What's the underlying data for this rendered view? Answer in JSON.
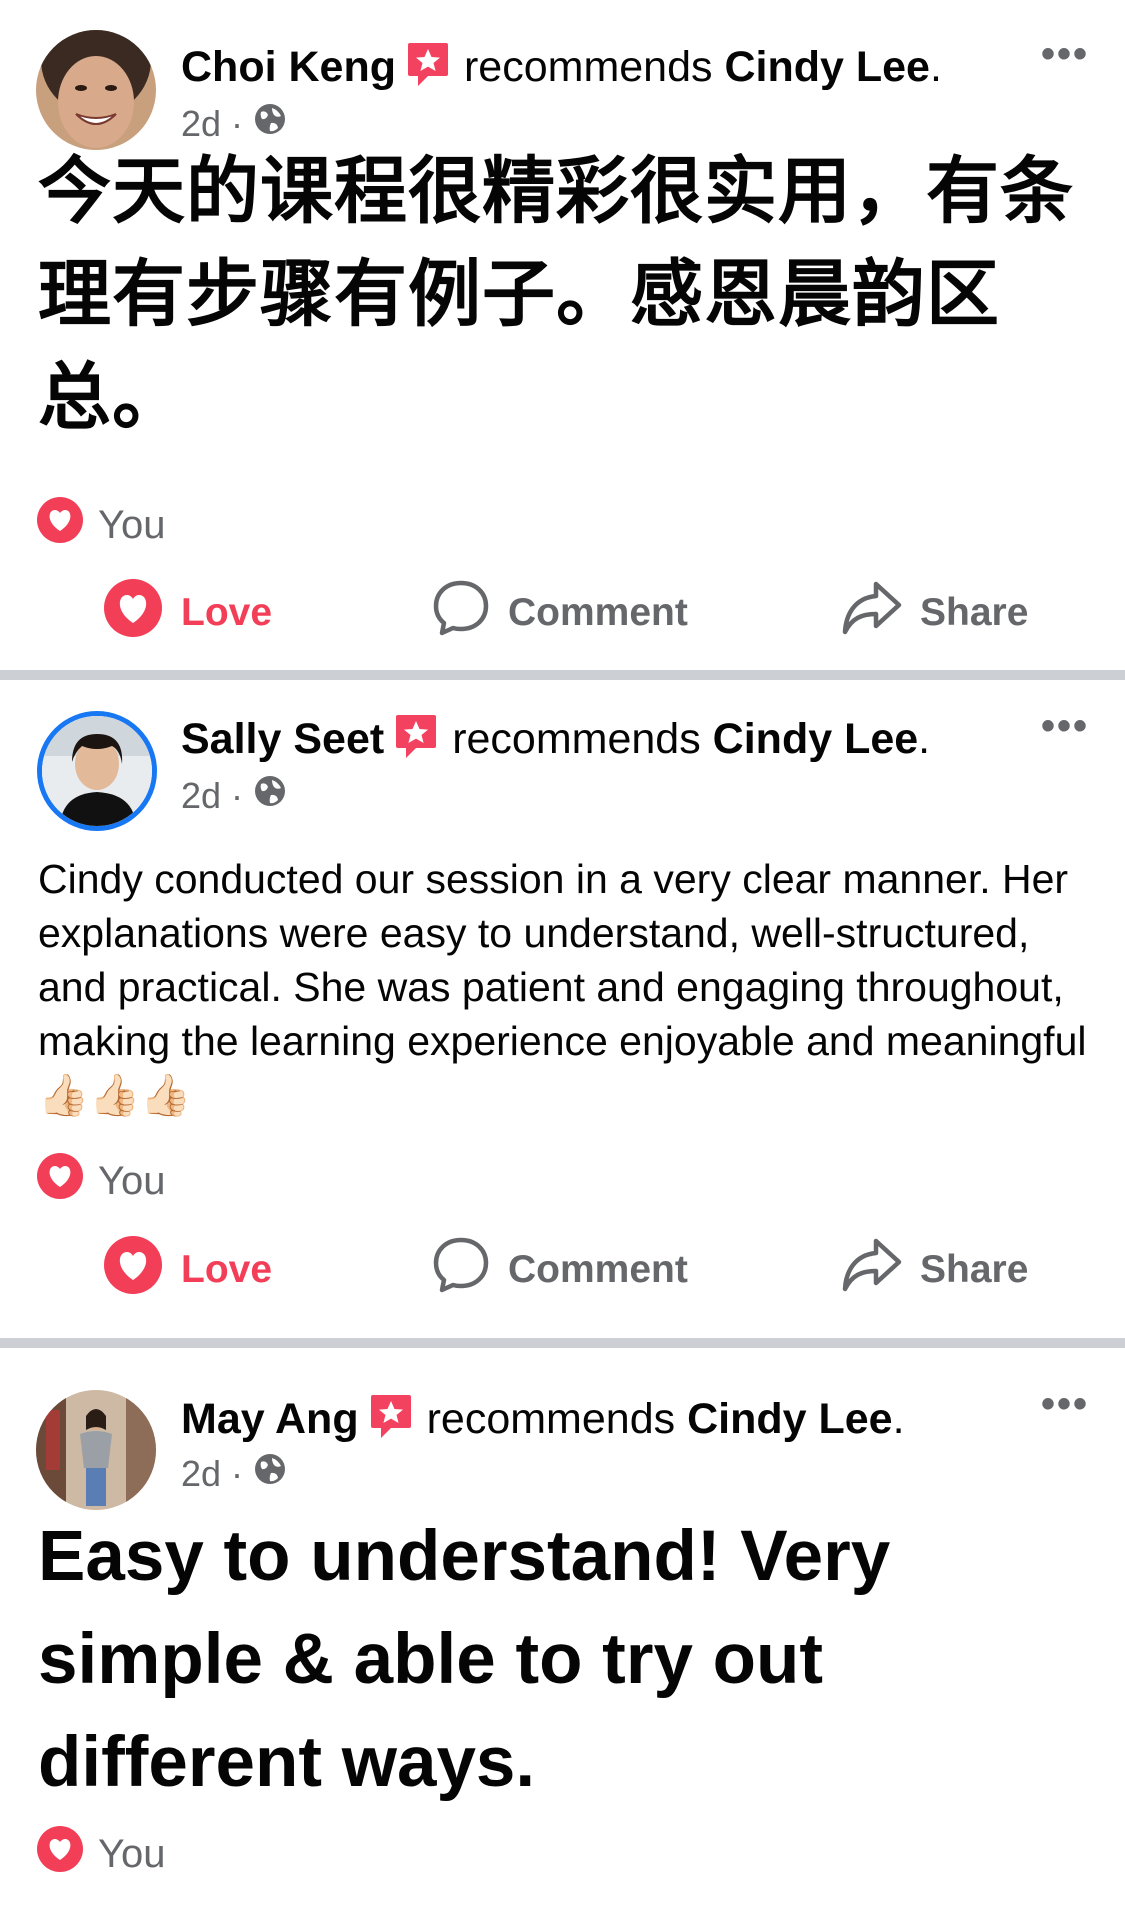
{
  "posts": [
    {
      "author": "Choi Keng",
      "recommends_label": "recommends",
      "page_name": "Cindy Lee",
      "time": "2d",
      "meta_sep": "·",
      "text": "今天的课程很精彩很实用，有条理有步骤有例子。感恩晨韵区总。",
      "reaction_label": "You",
      "actions": {
        "love": "Love",
        "comment": "Comment",
        "share": "Share"
      }
    },
    {
      "author": "Sally Seet",
      "recommends_label": "recommends",
      "page_name": "Cindy Lee",
      "time": "2d",
      "meta_sep": "·",
      "text": "Cindy conducted our session in a very clear manner. Her explanations were easy to understand, well-structured, and practical. She was patient and engaging throughout, making the learning experience enjoyable and meaningful 👍🏻👍🏻👍🏻",
      "reaction_label": "You",
      "actions": {
        "love": "Love",
        "comment": "Comment",
        "share": "Share"
      }
    },
    {
      "author": "May Ang",
      "recommends_label": "recommends",
      "page_name": "Cindy Lee",
      "time": "2d",
      "meta_sep": "·",
      "text": "Easy to understand! Very simple & able to try out different ways.",
      "reaction_label": "You"
    }
  ],
  "more_glyph": "•••",
  "period": ".",
  "colors": {
    "love": "#f33e58",
    "muted": "#65676b",
    "separator": "#ccd0d5",
    "avatar_ring": "#1877f2"
  },
  "icons": [
    "recommend-icon",
    "globe-icon",
    "heart-icon",
    "comment-icon",
    "share-icon",
    "more-icon"
  ]
}
